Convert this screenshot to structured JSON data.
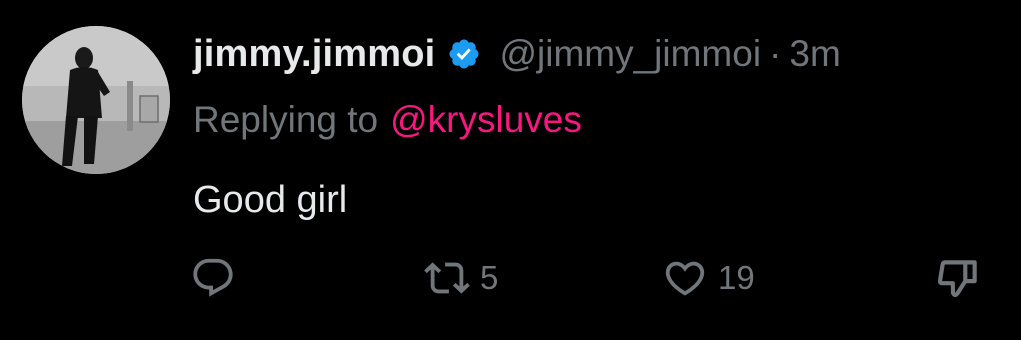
{
  "tweet": {
    "author": {
      "display_name": "jimmy.jimmoi",
      "handle": "@jimmy_jimmoi",
      "verified": true,
      "verified_color": "#1d9bf0"
    },
    "separator": "·",
    "time": "3m",
    "reply": {
      "prefix": "Replying to",
      "target": "@krysluves",
      "target_color": "#f91880"
    },
    "text": "Good girl",
    "actions": {
      "reply": {
        "icon": "reply-icon",
        "count": ""
      },
      "retweet": {
        "icon": "retweet-icon",
        "count": "5"
      },
      "like": {
        "icon": "heart-icon",
        "count": "19"
      },
      "dislike": {
        "icon": "thumbs-down-icon",
        "count": ""
      }
    }
  },
  "colors": {
    "background": "#000000",
    "primary_text": "#e7e9ea",
    "secondary_text": "#71767b"
  }
}
